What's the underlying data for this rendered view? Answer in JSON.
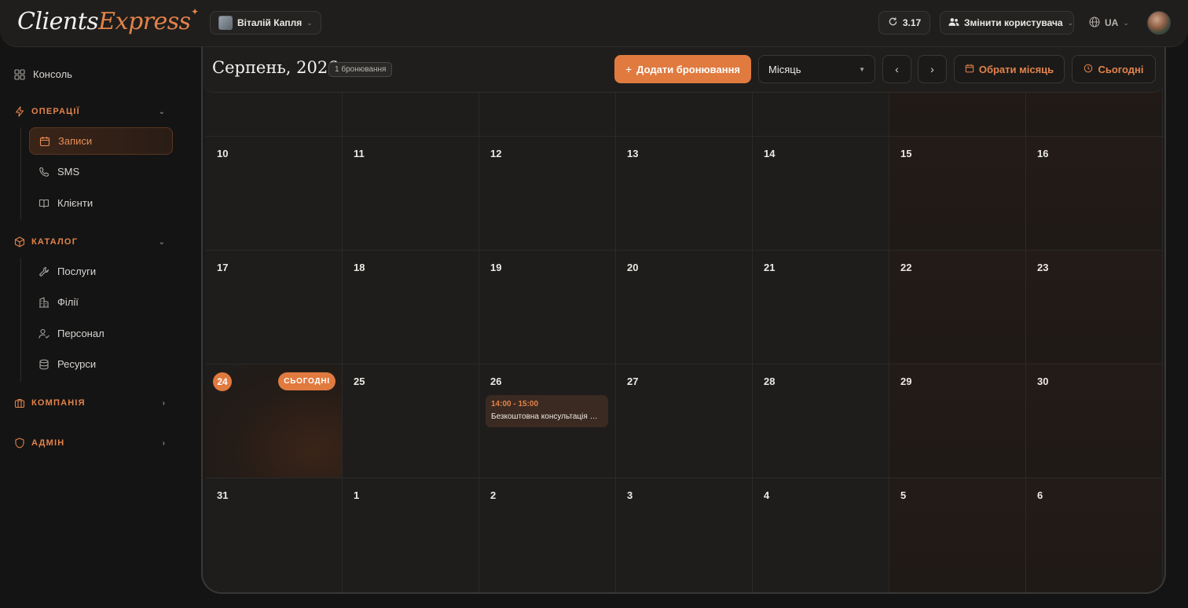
{
  "topbar": {
    "logo_part1": "Clients",
    "logo_part2": "Express",
    "account_name": "Віталій Капля",
    "version": "3.17",
    "switch_user_label": "Змінити користувача",
    "language": "UA"
  },
  "sidebar": {
    "console": "Консоль",
    "sections": [
      {
        "label": "ОПЕРАЦІЇ",
        "items": [
          "Записи",
          "SMS",
          "Клієнти"
        ]
      },
      {
        "label": "КАТАЛОГ",
        "items": [
          "Послуги",
          "Філії",
          "Персонал",
          "Ресурси"
        ]
      },
      {
        "label": "КОМПАНІЯ"
      },
      {
        "label": "АДМІН"
      }
    ]
  },
  "calendar": {
    "title": "Серпень, 2026",
    "booking_count": "1 бронювання",
    "add_booking_label": "Додати бронювання",
    "view_mode": "Місяць",
    "pick_month_label": "Обрати місяць",
    "today_label": "Сьогодні",
    "today_badge": "СЬОГОДНІ",
    "weeks": [
      [
        "",
        "",
        "",
        "",
        "",
        "",
        ""
      ],
      [
        "10",
        "11",
        "12",
        "13",
        "14",
        "15",
        "16"
      ],
      [
        "17",
        "18",
        "19",
        "20",
        "21",
        "22",
        "23"
      ],
      [
        "24",
        "25",
        "26",
        "27",
        "28",
        "29",
        "30"
      ],
      [
        "31",
        "1",
        "2",
        "3",
        "4",
        "5",
        "6"
      ]
    ],
    "today_day": "24",
    "event": {
      "time": "14:00 - 15:00",
      "title": "Безкоштовна консультація — ..."
    }
  },
  "colors": {
    "accent": "#e07a3f",
    "background": "#141414",
    "panel": "#1f1e1d"
  }
}
